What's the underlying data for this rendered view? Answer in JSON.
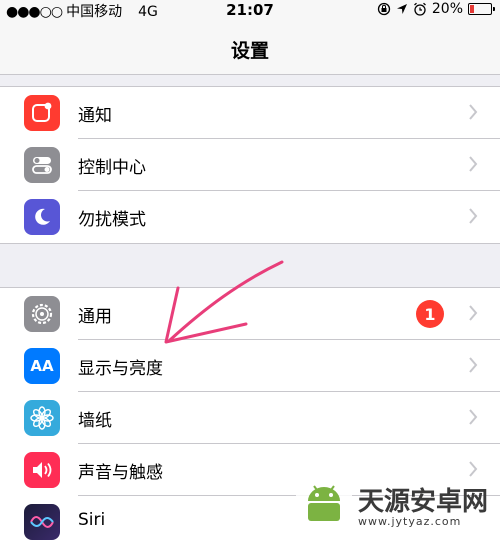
{
  "status_bar": {
    "signal_dots": "●●●○○",
    "carrier": "中国移动",
    "network": "4G",
    "time": "21:07",
    "battery_percent": "20%",
    "battery_level": 0.2
  },
  "nav": {
    "title": "设置"
  },
  "group1": {
    "items": [
      {
        "label": "通知",
        "icon": "notifications-icon",
        "color": "#ff3b30"
      },
      {
        "label": "控制中心",
        "icon": "control-center-icon",
        "color": "#8e8e93"
      },
      {
        "label": "勿扰模式",
        "icon": "moon-icon",
        "color": "#5856d6"
      }
    ]
  },
  "group2": {
    "items": [
      {
        "label": "通用",
        "icon": "gear-icon",
        "color": "#8e8e93",
        "badge": "1"
      },
      {
        "label": "显示与亮度",
        "icon": "display-brightness-icon",
        "color": "#007aff",
        "icon_text": "AA"
      },
      {
        "label": "墙纸",
        "icon": "wallpaper-icon",
        "color": "#35aadc"
      },
      {
        "label": "声音与触感",
        "icon": "speaker-icon",
        "color": "#ff2d55"
      },
      {
        "label": "Siri",
        "icon": "siri-icon",
        "color": "#1c1c3a"
      }
    ]
  },
  "watermark": {
    "title": "天源安卓网",
    "url": "www.jytyaz.com"
  }
}
